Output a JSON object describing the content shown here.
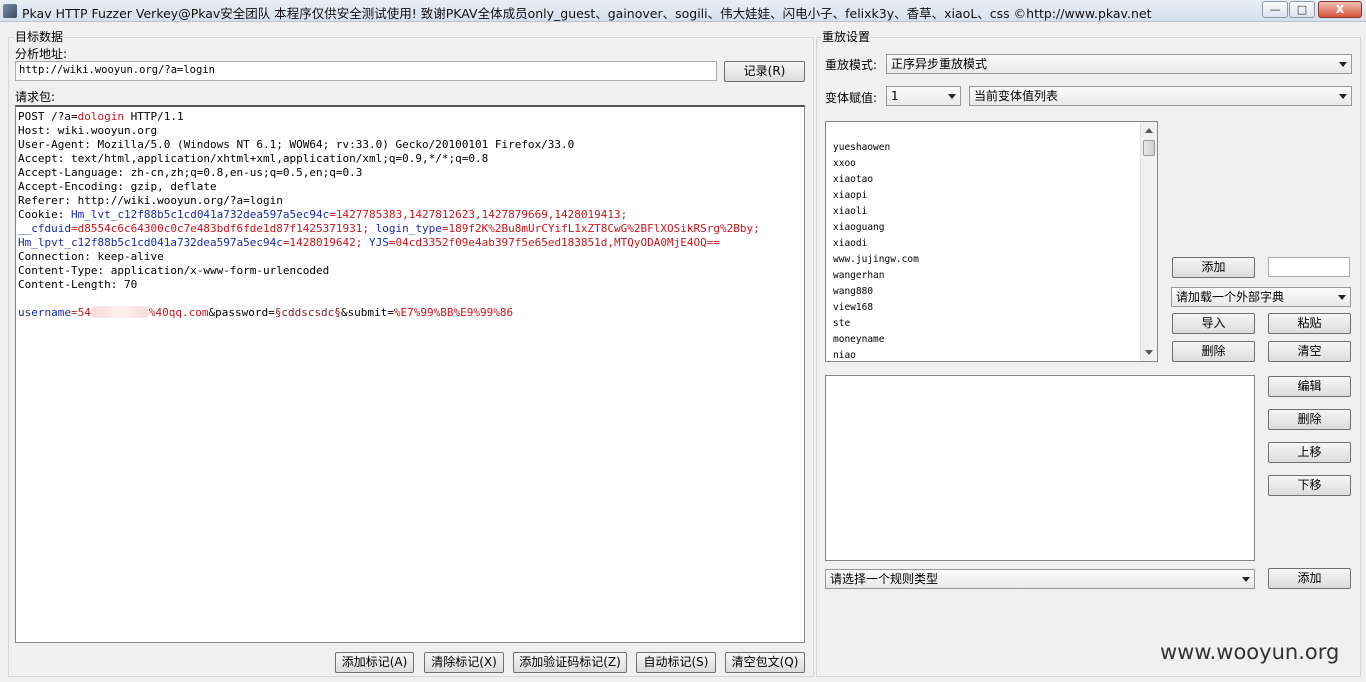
{
  "window": {
    "title": "Pkav HTTP Fuzzer   Verkey@Pkav安全团队  本程序仅供安全测试使用! 致谢PKAV全体成员only_guest、gainover、sogili、伟大娃娃、闪电小子、felixk3y、香草、xiaoL、css  ©http://www.pkav.net",
    "min_glyph": "—",
    "max_glyph": "□",
    "close_glyph": "X"
  },
  "left": {
    "group_title": "目标数据",
    "url_label": "分析地址:",
    "url_value": "http://wiki.wooyun.org/?a=login",
    "record_button": "记录(R)",
    "request_label": "请求包:",
    "request": {
      "line1_a": "POST /?a=",
      "line1_b": "dologin",
      "line1_c": " HTTP/1.1",
      "host": "Host: wiki.wooyun.org",
      "user_agent": "User-Agent: Mozilla/5.0 (Windows NT 6.1; WOW64; rv:33.0) Gecko/20100101 Firefox/33.0",
      "accept": "Accept: text/html,application/xhtml+xml,application/xml;q=0.9,*/*;q=0.8",
      "accept_language": "Accept-Language: zh-cn,zh;q=0.8,en-us;q=0.5,en;q=0.3",
      "accept_encoding": "Accept-Encoding: gzip, deflate",
      "referer": "Referer: http://wiki.wooyun.org/?a=login",
      "cookie_a": "Cookie: ",
      "cookie_b": "Hm_lvt_c12f88b5c1cd041a732dea597a5ec94c",
      "cookie_c": "=1427785383,1427812623,1427879669,1428019413;",
      "cookie2_a": "__cfduid",
      "cookie2_b": "=d8554c6c64300c0c7e483bdf6fde1d87f1425371931; ",
      "cookie2_c": "login_type",
      "cookie2_d": "=189f2K%2Bu8mUrCYifL1xZT8CwG%2BFlXOSikRSrg%2Bby;",
      "cookie3_a": "Hm_lpvt_c12f88b5c1cd041a732dea597a5ec94c",
      "cookie3_b": "=1428019642; ",
      "cookie3_c": "YJS",
      "cookie3_d": "=04cd3352f09e4ab397f5e65ed183851d,MTQyODA0MjE4OQ==",
      "connection": "Connection: keep-alive",
      "content_type": "Content-Type: application/x-www-form-urlencoded",
      "content_length": "Content-Length: 70",
      "body_a": "username",
      "body_b": "=54",
      "body_c": "%40qq.com",
      "body_d": "&password=",
      "body_e": "§cddscsdc§",
      "body_f": "&submit=",
      "body_g": "%E7%99%BB%E9%99%86"
    },
    "buttons": {
      "add_mark": "添加标记(A)",
      "clear_mark": "清除标记(X)",
      "add_captcha_mark": "添加验证码标记(Z)",
      "auto_mark": "自动标记(S)",
      "clear_request": "清空包文(Q)"
    }
  },
  "right": {
    "group_title": "重放设置",
    "replay_mode_label": "重放模式:",
    "replay_mode_value": "正序异步重放模式",
    "var_assign_label": "变体赋值:",
    "var_index_value": "1",
    "var_list_value": "当前变体值列表",
    "list_items": [
      "yueshaowen",
      "xxoo",
      "xiaotao",
      "xiaopi",
      "xiaoli",
      "xiaoguang",
      "xiaodi",
      "www.jujingw.com",
      "wangerhan",
      "wang880",
      "view168",
      "ste",
      "moneyname",
      "niao"
    ],
    "add_button": "添加",
    "add_input_value": "",
    "dict_select_value": "请加载一个外部字典",
    "import_button": "导入",
    "paste_button": "粘贴",
    "delete_button": "删除",
    "clear_button": "清空",
    "edit_button": "编辑",
    "rule_delete_button": "删除",
    "move_up_button": "上移",
    "move_down_button": "下移",
    "rule_type_value": "请选择一个规则类型",
    "rule_add_button": "添加"
  },
  "watermark": "www.wooyun.org"
}
